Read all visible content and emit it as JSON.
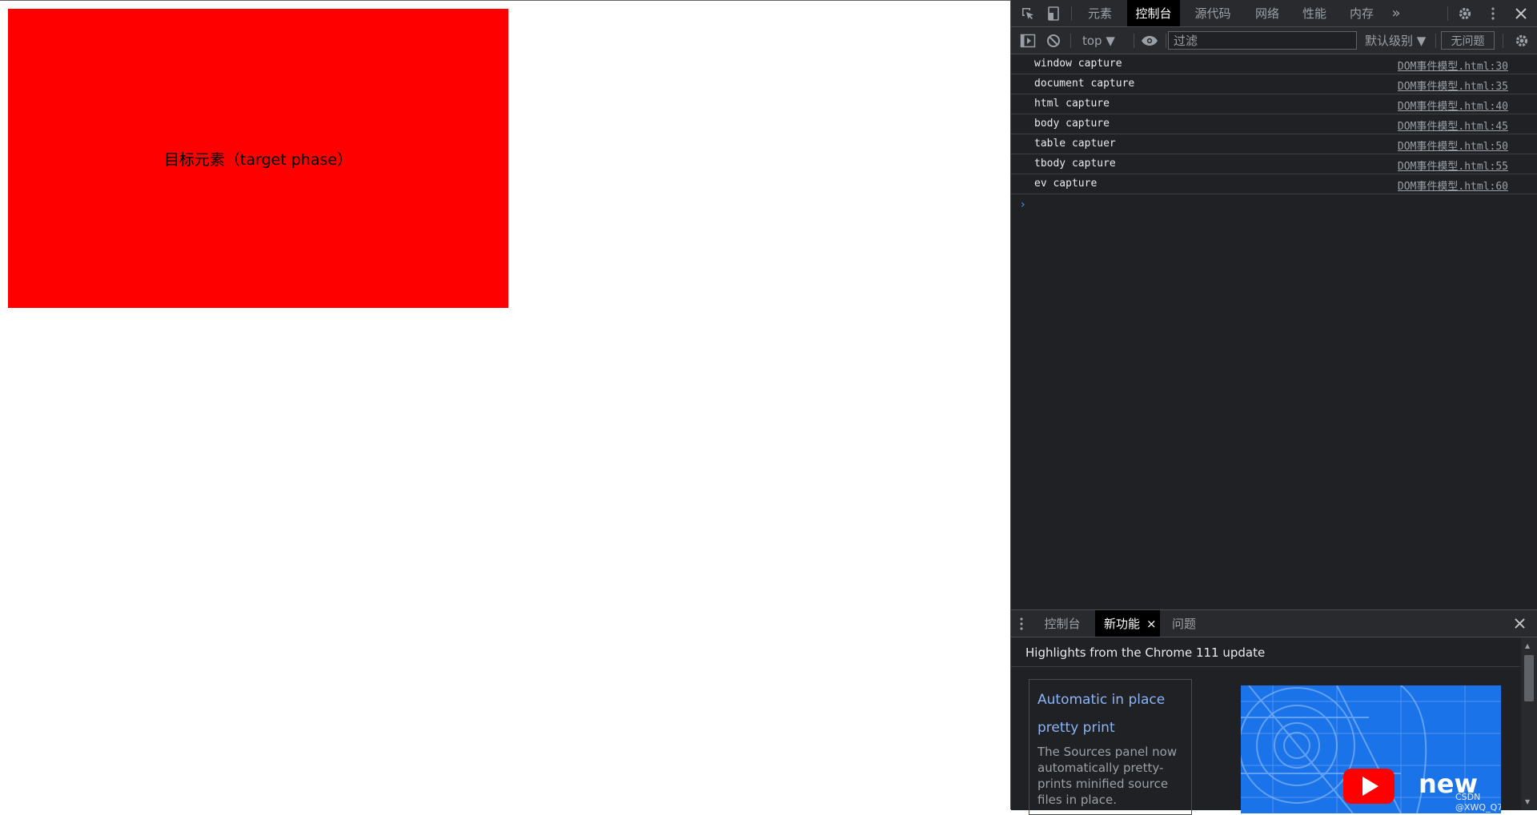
{
  "page": {
    "target_text": "目标元素（target phase）",
    "target_color": "#ff0000"
  },
  "devtools": {
    "tabs": [
      "元素",
      "控制台",
      "源代码",
      "网络",
      "性能",
      "内存"
    ],
    "active_tab": "控制台",
    "more_tabs": "»",
    "toolbar": {
      "context": "top ▼",
      "filter_placeholder": "过滤",
      "level": "默认级别 ▼",
      "issues": "无问题"
    },
    "console_logs": [
      {
        "message": "window capture",
        "source": "DOM事件模型.html:30"
      },
      {
        "message": "document capture",
        "source": "DOM事件模型.html:35"
      },
      {
        "message": "html capture",
        "source": "DOM事件模型.html:40"
      },
      {
        "message": "body capture",
        "source": "DOM事件模型.html:45"
      },
      {
        "message": "table captuer",
        "source": "DOM事件模型.html:50"
      },
      {
        "message": "tbody capture",
        "source": "DOM事件模型.html:55"
      },
      {
        "message": "ev capture",
        "source": "DOM事件模型.html:60"
      }
    ],
    "prompt": "›",
    "drawer": {
      "tabs": [
        "控制台",
        "新功能",
        "问题"
      ],
      "active_tab": "新功能",
      "close_tab": "×",
      "heading": "Highlights from the Chrome 111 update",
      "card": {
        "title_line1": "Automatic in place",
        "title_line2": "pretty print",
        "description": "The Sources panel now automatically pretty-prints minified source files in place."
      },
      "video_caption": "new",
      "watermark": "CSDN @XWQ_Q7"
    },
    "colors": {
      "panel_bg": "#202124",
      "toolbar_bg": "#292a2d",
      "link": "#8ab4f8",
      "video_bg": "#1a73e8"
    }
  }
}
